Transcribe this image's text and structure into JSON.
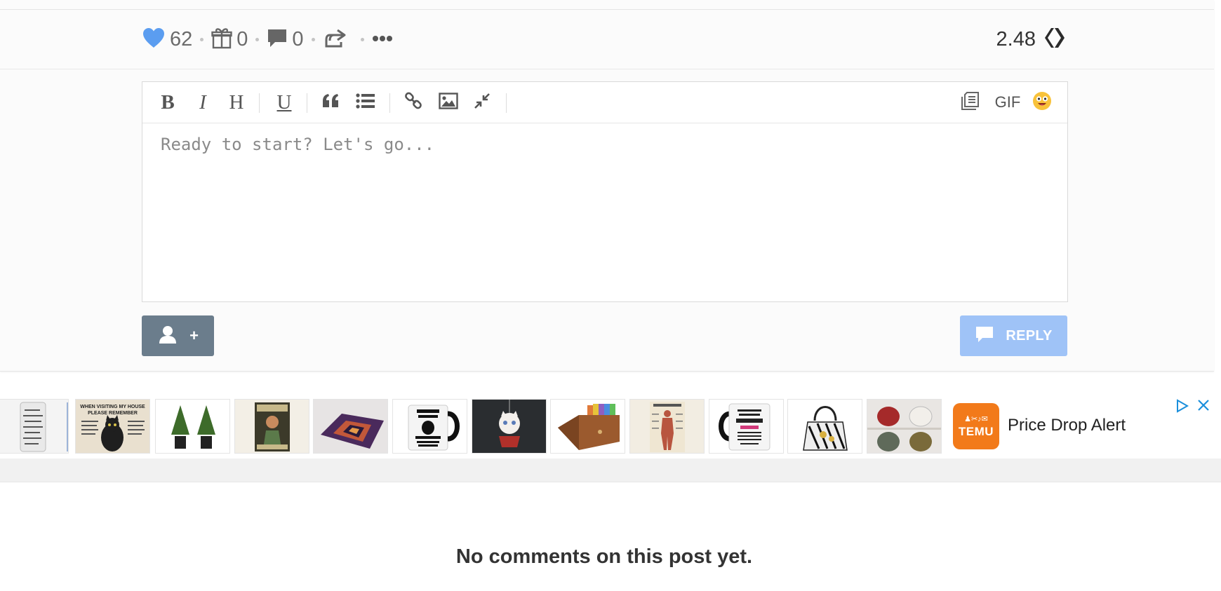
{
  "post_actions": {
    "votes": "62",
    "gifts": "0",
    "comments": "0",
    "payout": "2.48",
    "icons": [
      "heart-icon",
      "gift-icon",
      "comment-icon",
      "share-icon",
      "more-icon",
      "hive-icon"
    ],
    "colors": {
      "heart": "#5b9df0",
      "icon_gray": "#666666"
    }
  },
  "editor": {
    "placeholder": "Ready to start? Let's go...",
    "toolbar": {
      "bold": "B",
      "italic": "I",
      "heading": "H",
      "underline": "U",
      "gif": "GIF",
      "icons": [
        "quote-icon",
        "list-icon",
        "link-icon",
        "image-icon",
        "collapse-icon",
        "snippets-icon",
        "emoji-icon"
      ]
    }
  },
  "buttons": {
    "mention_plus": "+",
    "reply": "REPLY",
    "colors": {
      "mention": "#6b7d8c",
      "reply": "#9fc3f7"
    }
  },
  "ad": {
    "brand": "TEMU",
    "title": "Price Drop Alert",
    "thumbnails": [
      "tumbler",
      "cat-sign",
      "topiary-trees",
      "vintage-poster",
      "optical-rug",
      "black-mug",
      "cat-ornament",
      "coin-wallet",
      "anatomy-poster",
      "brother-mug",
      "zebra-bag",
      "teapots"
    ],
    "thumb_texts": {
      "cat_sign_line1": "WHEN VISITING MY HOUSE",
      "cat_sign_line2": "PLEASE REMEMBER"
    },
    "brand_color": "#f27a1a"
  },
  "comments": {
    "empty_message": "No comments on this post yet."
  }
}
